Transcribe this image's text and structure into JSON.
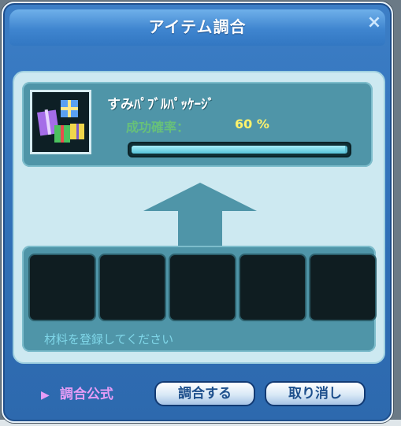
{
  "window": {
    "title": "アイテム調合",
    "close_label": "×"
  },
  "item": {
    "name": "すみﾊﾟﾌﾞﾙﾊﾟｯｹｰｼﾞ",
    "success_rate_label": "成功確率：",
    "success_rate_value": "60 %",
    "progress_fraction": 0.99,
    "icon": "gift-boxes-icon"
  },
  "materials": {
    "slots": [
      "",
      "",
      "",
      "",
      ""
    ],
    "hint": "材料を登録してください"
  },
  "footer": {
    "formula_marker": "▶",
    "formula_label": "調合公式",
    "combine_button": "調合する",
    "cancel_button": "取り消し"
  },
  "colors": {
    "window_blue": "#3c7ec6",
    "panel_teal": "#4f95a8",
    "content_light": "#cde9f1",
    "rate_label_green": "#67c07a",
    "rate_value_yellow": "#fff36b",
    "formula_pink": "#e69cf6"
  }
}
